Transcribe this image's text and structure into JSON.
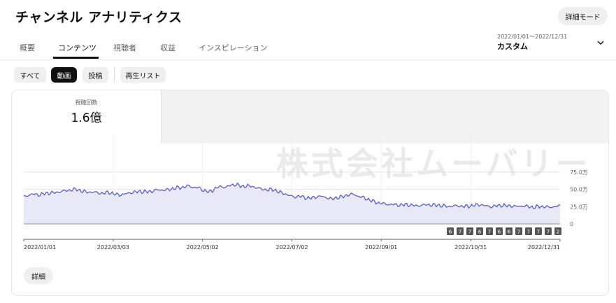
{
  "header": {
    "title": "チャンネル アナリティクス",
    "advanced_button": "詳細モード"
  },
  "tabs": [
    {
      "label": "概要",
      "active": false
    },
    {
      "label": "コンテンツ",
      "active": true
    },
    {
      "label": "視聴者",
      "active": false
    },
    {
      "label": "収益",
      "active": false
    },
    {
      "label": "インスピレーション",
      "active": false
    }
  ],
  "date_picker": {
    "range": "2022/01/01〜2022/12/31",
    "label": "カスタム",
    "icon": "chevron-down-icon"
  },
  "filters": [
    {
      "label": "すべて",
      "active": false
    },
    {
      "label": "動画",
      "active": true
    },
    {
      "label": "投稿",
      "active": false
    },
    {
      "label": "再生リスト",
      "active": false
    }
  ],
  "metric": {
    "label": "視聴回数",
    "value": "1.6億"
  },
  "watermark": "株式会社ムーバリー",
  "details_button": "詳細",
  "colors": {
    "line": "#5c5ccf",
    "fill": "#e8e8f7",
    "badge": "#555555"
  },
  "chart_data": {
    "type": "area",
    "x_tick_labels": [
      "2022/01/01",
      "2022/03/03",
      "2022/05/02",
      "2022/07/02",
      "2022/09/01",
      "2022/10/31",
      "2022/12/31"
    ],
    "y_tick_labels": [
      "75.0万",
      "50.0万",
      "25.0万",
      "0"
    ],
    "ylim": [
      0,
      100
    ],
    "y_unit": "万",
    "grid": true,
    "legend": "none",
    "weekly_values": [
      39,
      42,
      43,
      42,
      44,
      45,
      45,
      47,
      48,
      49,
      50,
      47,
      46,
      46,
      45,
      44,
      46,
      43,
      42,
      43,
      45,
      46,
      47,
      46,
      47,
      49,
      49,
      49,
      51,
      52,
      53,
      55,
      53,
      52,
      48,
      46,
      51,
      54,
      53,
      56,
      57,
      54,
      55,
      54,
      52,
      50,
      49,
      50,
      46,
      44,
      41,
      39,
      40,
      38,
      37,
      39,
      40,
      38,
      36,
      38,
      39,
      42,
      43,
      40,
      38,
      35,
      32,
      30,
      29,
      28,
      28,
      27,
      28,
      27,
      26,
      27,
      28,
      27,
      27,
      26,
      25,
      26,
      26,
      25,
      26,
      27,
      28,
      26,
      25,
      26,
      27,
      26,
      26,
      25,
      26,
      25,
      24,
      25,
      25,
      24,
      25,
      26
    ],
    "badges": [
      "6",
      "7",
      "7",
      "6",
      "7",
      "6",
      "6",
      "7",
      "7",
      "7",
      "7",
      "2"
    ]
  }
}
